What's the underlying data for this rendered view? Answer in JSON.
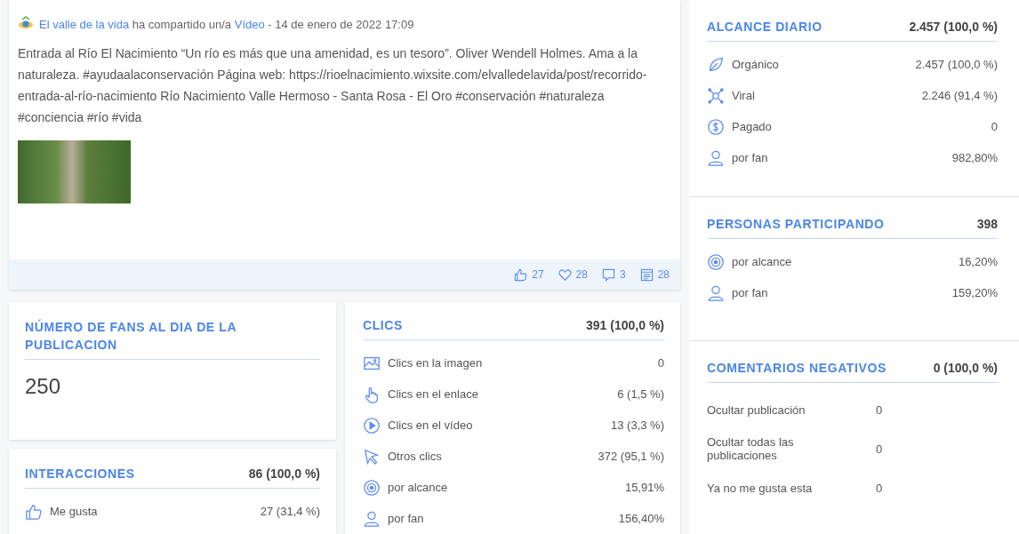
{
  "post": {
    "author": "El valle de la vida",
    "action": "ha compartido un/a",
    "media_type": "Vídeo",
    "date": "- 14 de enero de 2022 17:09",
    "text": "Entrada al Río El Nacimiento “Un río es más que una amenidad, es un tesoro”. Oliver Wendell Holmes. Ama a la naturaleza. #ayudaalaconservación Página web: https://rioelnacimiento.wixsite.com/elvalledelavida/post/recorrido-entrada-al-río-nacimiento Río Nacimiento Valle Hermoso - Santa Rosa - El Oro #conservación #naturaleza #conciencia #río #vida",
    "counts": [
      {
        "kind": "like",
        "value": "27"
      },
      {
        "kind": "heart",
        "value": "28"
      },
      {
        "kind": "comment",
        "value": "3"
      },
      {
        "kind": "views",
        "value": "28"
      }
    ]
  },
  "fans_card": {
    "title": "NÚMERO DE FANS AL DIA DE LA PUBLICACION",
    "value": "250"
  },
  "interactions": {
    "title": "INTERACCIONES",
    "total": "86 (100,0 %)",
    "rows": [
      {
        "kind": "thumb",
        "label": "Me gusta",
        "value": "27 (31,4 %)"
      }
    ]
  },
  "clicks": {
    "title": "CLICS",
    "total": "391 (100,0 %)",
    "rows": [
      {
        "kind": "image",
        "label": "Clics en la imagen",
        "value": "0"
      },
      {
        "kind": "hand",
        "label": "Clics en el enlace",
        "value": "6 (1,5 %)"
      },
      {
        "kind": "play",
        "label": "Clics en el vídeo",
        "value": "13 (3,3 %)"
      },
      {
        "kind": "cursor",
        "label": "Otros clics",
        "value": "372 (95,1 %)"
      },
      {
        "kind": "target",
        "label": "por alcance",
        "value": "15,91%"
      },
      {
        "kind": "person",
        "label": "por fan",
        "value": "156,40%"
      }
    ]
  },
  "daily_reach": {
    "title": "ALCANCE DIARIO",
    "total": "2.457 (100,0 %)",
    "rows": [
      {
        "kind": "leaf",
        "label": "Orgánico",
        "value": "2.457 (100,0 %)"
      },
      {
        "kind": "viral",
        "label": "Viral",
        "value": "2.246 (91,4 %)"
      },
      {
        "kind": "dollar",
        "label": "Pagado",
        "value": "0"
      },
      {
        "kind": "person",
        "label": "por fan",
        "value": "982,80%"
      }
    ]
  },
  "people_engaged": {
    "title": "PERSONAS PARTICIPANDO",
    "total": "398",
    "rows": [
      {
        "kind": "target",
        "label": "por alcance",
        "value": "16,20%"
      },
      {
        "kind": "person",
        "label": "por fan",
        "value": "159,20%"
      }
    ]
  },
  "negative_comments": {
    "title": "COMENTARIOS NEGATIVOS",
    "total": "0 (100,0 %)",
    "rows": [
      {
        "kind": "plain",
        "label": "Ocultar publicación",
        "value": "0"
      },
      {
        "kind": "plain",
        "label": "Ocultar todas las publicaciones",
        "value": "0"
      },
      {
        "kind": "plain",
        "label": "Ya no me gusta esta",
        "value": "0"
      }
    ]
  }
}
